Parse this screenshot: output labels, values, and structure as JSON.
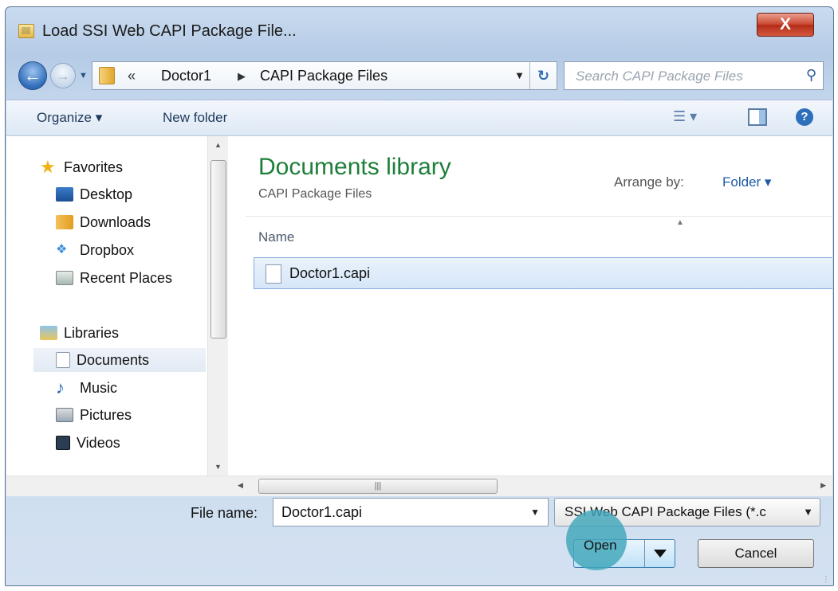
{
  "window": {
    "title": "Load SSI Web CAPI Package File...",
    "close_label": "X"
  },
  "nav": {
    "back_icon": "back-arrow-icon",
    "forward_icon": "forward-arrow-icon",
    "breadcrumb": {
      "overflow": "«",
      "items": [
        "Doctor1",
        "CAPI Package Files"
      ]
    },
    "search_placeholder": "Search CAPI Package Files"
  },
  "toolbar": {
    "organize_label": "Organize ▾",
    "new_folder_label": "New folder"
  },
  "sidebar": {
    "favorites": "Favorites",
    "favorite_items": [
      "Desktop",
      "Downloads",
      "Dropbox",
      "Recent Places"
    ],
    "libraries": "Libraries",
    "library_items": [
      "Documents",
      "Music",
      "Pictures",
      "Videos"
    ],
    "selected": "Documents"
  },
  "library": {
    "title": "Documents library",
    "subtitle": "CAPI Package Files",
    "arrange_label": "Arrange by:",
    "arrange_value": "Folder ▾"
  },
  "file_list": {
    "column_name": "Name",
    "files": [
      "Doctor1.capi"
    ]
  },
  "bottom": {
    "file_name_label": "File name:",
    "file_name_value": "Doctor1.capi",
    "filter_value": "SSI Web CAPI Package Files (*.c",
    "open_label": "Open",
    "cancel_label": "Cancel"
  },
  "colors": {
    "library_title": "#1e7f3a",
    "highlight": "#40a6ba",
    "close_button": "#c9452f"
  }
}
